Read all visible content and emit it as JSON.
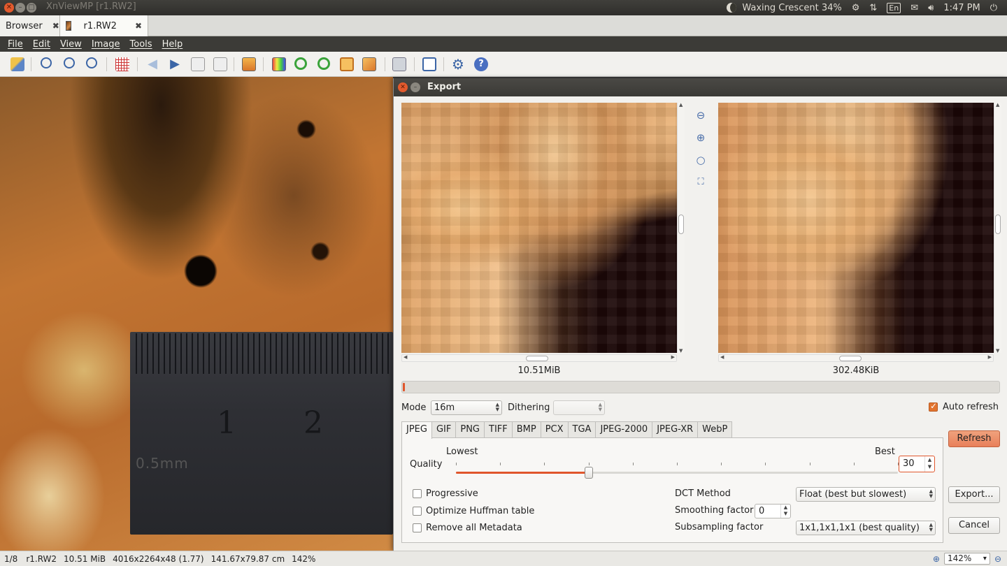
{
  "system": {
    "app_title": "XnViewMP [r1.RW2]",
    "moon": "Waxing Crescent 34%",
    "lang": "En",
    "clock": "1:47 PM"
  },
  "tabs": [
    {
      "label": "Browser"
    },
    {
      "label": "r1.RW2"
    }
  ],
  "menu": [
    "File",
    "Edit",
    "View",
    "Image",
    "Tools",
    "Help"
  ],
  "ruler": {
    "n1": "1",
    "n2": "2",
    "unit": "0.5mm"
  },
  "export": {
    "title": "Export",
    "original_size": "10.51MiB",
    "preview_size": "302.48KiB",
    "progress": 0.003,
    "mode_label": "Mode",
    "mode_value": "16m",
    "dithering_label": "Dithering",
    "dithering_value": "",
    "auto_refresh_label": "Auto refresh",
    "auto_refresh_checked": true,
    "formats": [
      "JPEG",
      "GIF",
      "PNG",
      "TIFF",
      "BMP",
      "PCX",
      "TGA",
      "JPEG-2000",
      "JPEG-XR",
      "WebP"
    ],
    "active_format": "JPEG",
    "quality_label": "Quality",
    "lowest_label": "Lowest",
    "best_label": "Best",
    "quality_value": "30",
    "quality_fraction": 0.3,
    "progressive_label": "Progressive",
    "optimize_label": "Optimize Huffman table",
    "remove_meta_label": "Remove all Metadata",
    "dct_label": "DCT Method",
    "dct_value": "Float (best but slowest)",
    "smoothing_label": "Smoothing factor",
    "smoothing_value": "0",
    "subsampling_label": "Subsampling factor",
    "subsampling_value": "1x1,1x1,1x1 (best quality)",
    "refresh_button": "Refresh",
    "export_button": "Export...",
    "cancel_button": "Cancel"
  },
  "status": {
    "index": "1/8",
    "file": "r1.RW2",
    "size": "10.51 MiB",
    "dims": "4016x2264x48 (1.77)",
    "print": "141.67x79.87 cm",
    "zoom1": "142%",
    "zoom2": "142%"
  },
  "colors": {
    "accent": "#e0562c",
    "menubar": "#3c3b37"
  }
}
